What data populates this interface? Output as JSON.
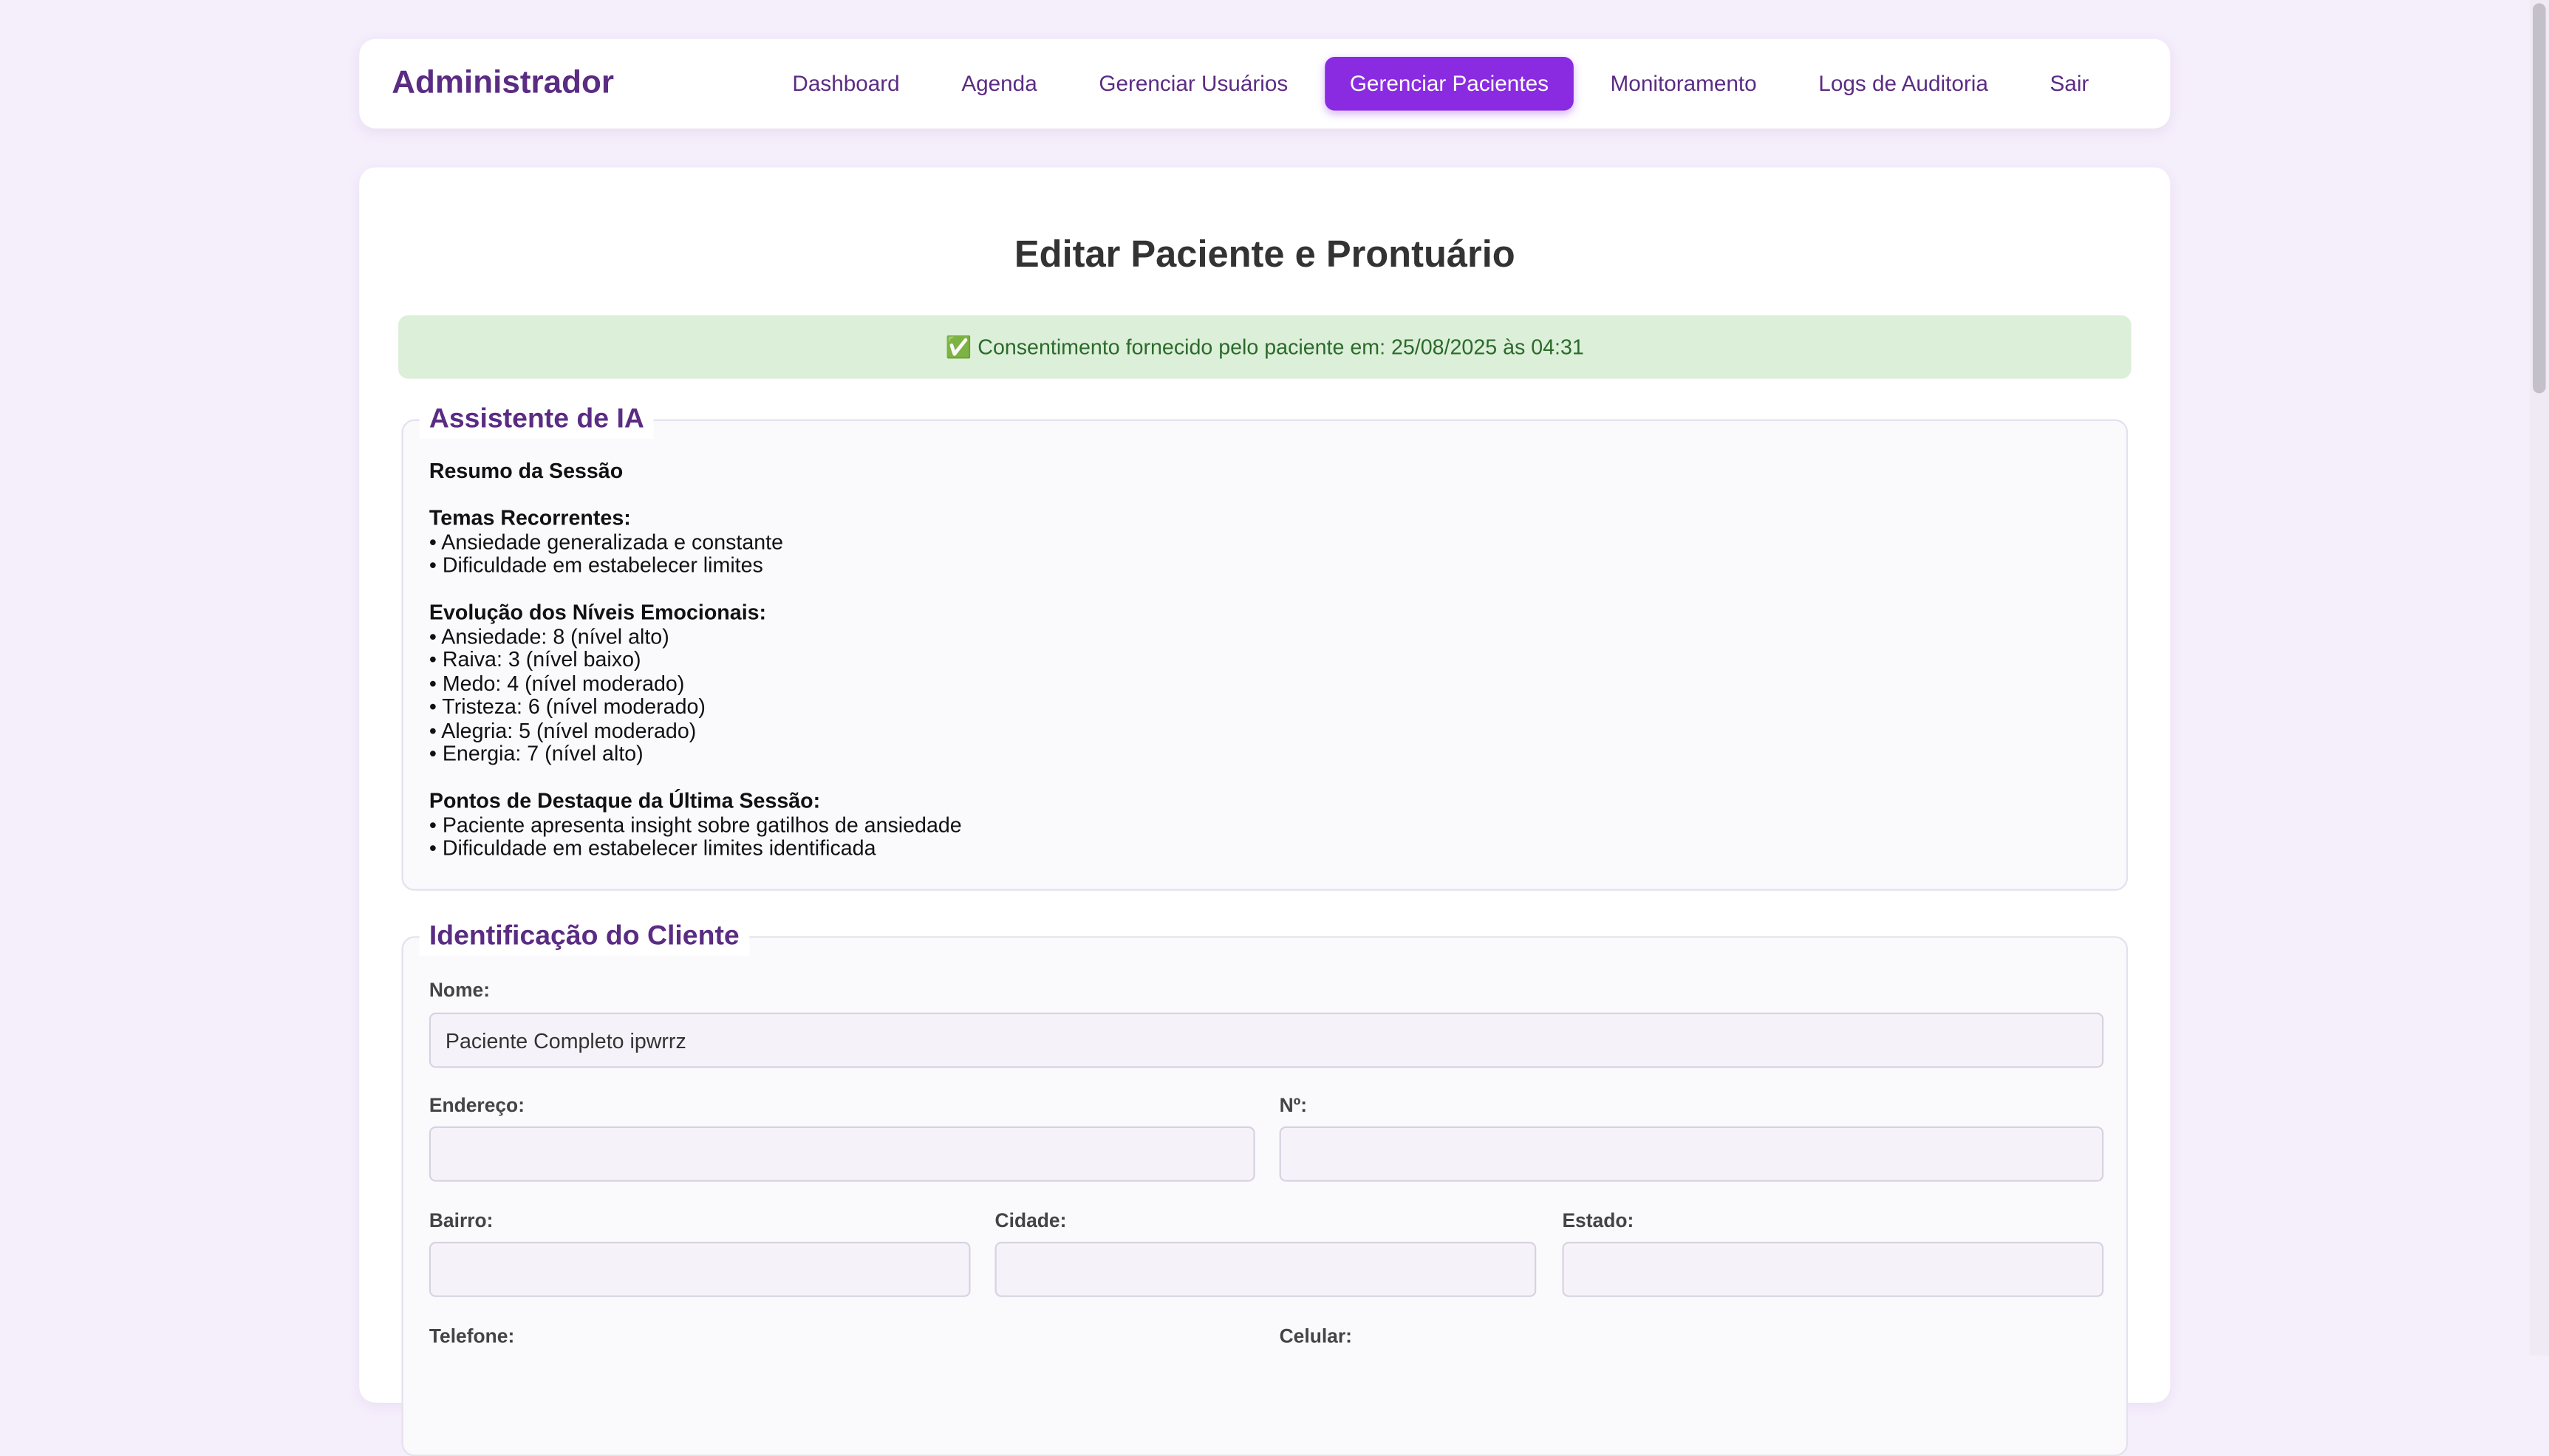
{
  "navbar": {
    "brand": "Administrador",
    "links": [
      {
        "label": "Dashboard",
        "active": false
      },
      {
        "label": "Agenda",
        "active": false
      },
      {
        "label": "Gerenciar Usuários",
        "active": false
      },
      {
        "label": "Gerenciar Pacientes",
        "active": true
      },
      {
        "label": "Monitoramento",
        "active": false
      },
      {
        "label": "Logs de Auditoria",
        "active": false
      },
      {
        "label": "Sair",
        "active": false
      }
    ]
  },
  "page": {
    "title": "Editar Paciente e Prontuário",
    "consent": "✅ Consentimento fornecido pelo paciente em: 25/08/2025 às 04:31"
  },
  "ai_assistant": {
    "legend": "Assistente de IA",
    "summary_title": "Resumo da Sessão",
    "themes_title": "Temas Recorrentes:",
    "themes": [
      "• Ansiedade generalizada e constante",
      "• Dificuldade em estabelecer limites"
    ],
    "emotions_title": "Evolução dos Níveis Emocionais:",
    "emotions": [
      "• Ansiedade: 8 (nível alto)",
      "• Raiva: 3 (nível baixo)",
      "• Medo: 4 (nível moderado)",
      "• Tristeza: 6 (nível moderado)",
      "• Alegria: 5 (nível moderado)",
      "• Energia: 7 (nível alto)"
    ],
    "highlights_title": "Pontos de Destaque da Última Sessão:",
    "highlights": [
      "• Paciente apresenta insight sobre gatilhos de ansiedade",
      "• Dificuldade em estabelecer limites identificada"
    ]
  },
  "client_id": {
    "legend": "Identificação do Cliente",
    "name_label": "Nome:",
    "name_value": "Paciente Completo ipwrrz",
    "address_label": "Endereço:",
    "address_value": "",
    "number_label": "Nº:",
    "number_value": "",
    "district_label": "Bairro:",
    "district_value": "",
    "city_label": "Cidade:",
    "city_value": "",
    "state_label": "Estado:",
    "state_value": "",
    "phone_label": "Telefone:",
    "mobile_label": "Celular:"
  },
  "colors": {
    "accent": "#8a2be2",
    "brand": "#5b2c83",
    "success_bg": "#dcefd8",
    "success_text": "#2c6a2c"
  }
}
